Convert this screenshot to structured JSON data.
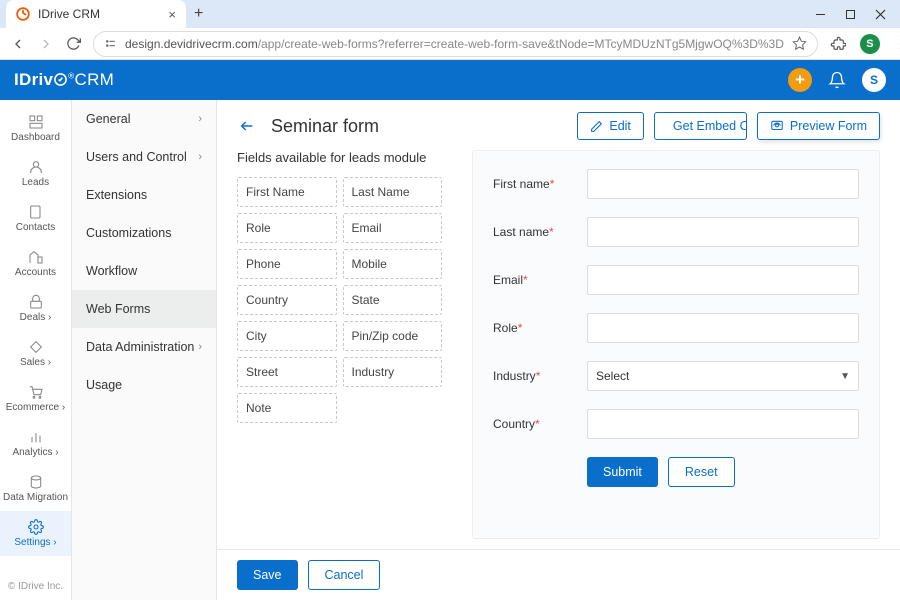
{
  "browser": {
    "tab_title": "IDrive CRM",
    "url_host": "design.devidrivecrm.com",
    "url_path": "/app/create-web-forms?referrer=create-web-form-save&tNode=MTcyMDUzNTg5MjgwOQ%3D%3D",
    "avatar_initial": "S"
  },
  "brand": {
    "part1": "IDriv",
    "part2": "CRM"
  },
  "header_avatar": "S",
  "nav_rail": [
    {
      "label": "Dashboard"
    },
    {
      "label": "Leads"
    },
    {
      "label": "Contacts"
    },
    {
      "label": "Accounts"
    },
    {
      "label": "Deals ›"
    },
    {
      "label": "Sales ›"
    },
    {
      "label": "Ecommerce ›"
    },
    {
      "label": "Analytics ›"
    },
    {
      "label": "Data Migration"
    },
    {
      "label": "Settings ›"
    }
  ],
  "rail_footer": "© IDrive Inc.",
  "sidebar": [
    {
      "label": "General",
      "arrow": true
    },
    {
      "label": "Users and Control",
      "arrow": true
    },
    {
      "label": "Extensions"
    },
    {
      "label": "Customizations"
    },
    {
      "label": "Workflow"
    },
    {
      "label": "Web Forms",
      "selected": true
    },
    {
      "label": "Data Administration",
      "arrow": true
    },
    {
      "label": "Usage"
    }
  ],
  "page": {
    "title": "Seminar form",
    "edit": "Edit",
    "embed": "Get Embed Code",
    "preview": "Preview Form"
  },
  "fields_title": "Fields available for leads module",
  "available_fields": [
    "First Name",
    "Last Name",
    "Role",
    "Email",
    "Phone",
    "Mobile",
    "Country",
    "State",
    "City",
    "Pin/Zip code",
    "Street",
    "Industry",
    "Note"
  ],
  "form": {
    "rows": [
      {
        "label": "First name",
        "required": true,
        "type": "text"
      },
      {
        "label": "Last name",
        "required": true,
        "type": "text"
      },
      {
        "label": "Email",
        "required": true,
        "type": "text"
      },
      {
        "label": "Role",
        "required": true,
        "type": "text"
      },
      {
        "label": "Industry",
        "required": true,
        "type": "select",
        "selected": "Select"
      },
      {
        "label": "Country",
        "required": true,
        "type": "text"
      }
    ],
    "submit": "Submit",
    "reset": "Reset"
  },
  "footer": {
    "save": "Save",
    "cancel": "Cancel"
  }
}
